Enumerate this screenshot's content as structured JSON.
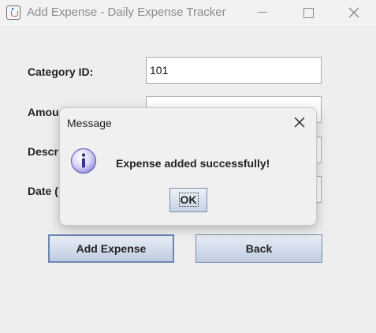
{
  "window": {
    "title": "Add Expense - Daily Expense Tracker",
    "controls": [
      "minimize",
      "maximize",
      "close"
    ]
  },
  "form": {
    "category_label": "Category ID:",
    "category_value": "101",
    "amount_label": "Amou",
    "description_label": "Descr",
    "date_label": "Date ("
  },
  "buttons": {
    "add_expense": "Add Expense",
    "back": "Back"
  },
  "dialog": {
    "title": "Message",
    "message": "Expense added successfully!",
    "ok_label": "OK",
    "icon": "info-icon"
  },
  "colors": {
    "button_border": "#7a8ca8",
    "button_gradient_top": "#e7edf6",
    "button_gradient_bottom": "#bfcde0",
    "info_icon": "#8f89d8"
  }
}
